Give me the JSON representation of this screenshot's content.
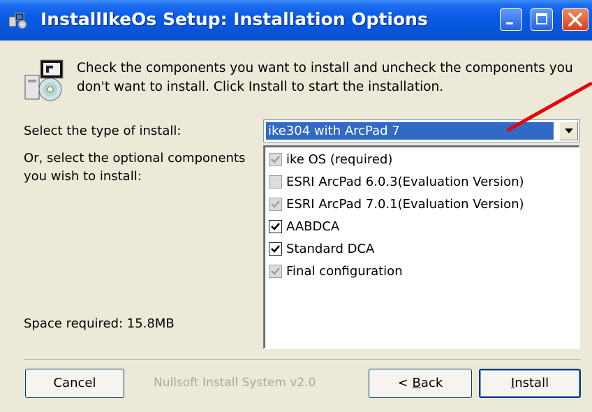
{
  "window": {
    "title": "InstallIkeOs Setup: Installation Options"
  },
  "header": {
    "description": "Check the components you want to install and uncheck the components you don't want to install. Click Install to start the installation."
  },
  "form": {
    "install_type_label": "Select the type of install:",
    "install_type_value": "ike304 with ArcPad 7",
    "optional_label": "Or, select the optional components you wish to install:",
    "space_required": "Space required: 15.8MB"
  },
  "components": [
    {
      "label": "ike OS (required)",
      "checked": true,
      "disabled": true
    },
    {
      "label": "ESRI ArcPad 6.0.3(Evaluation Version)",
      "checked": false,
      "disabled": true
    },
    {
      "label": "ESRI ArcPad 7.0.1(Evaluation Version)",
      "checked": true,
      "disabled": true
    },
    {
      "label": "AABDCA",
      "checked": true,
      "disabled": false
    },
    {
      "label": "Standard DCA",
      "checked": true,
      "disabled": false
    },
    {
      "label": "Final configuration",
      "checked": true,
      "disabled": true
    }
  ],
  "footer": {
    "cancel_label": "Cancel",
    "branding": "Nullsoft Install System v2.0",
    "back_prefix": "< ",
    "back_accel": "B",
    "back_rest": "ack",
    "install_accel": "I",
    "install_rest": "nstall"
  },
  "colors": {
    "title_bar": "#0a5ce6",
    "selection": "#316ac5",
    "annotation_arrow": "#e8000b"
  }
}
